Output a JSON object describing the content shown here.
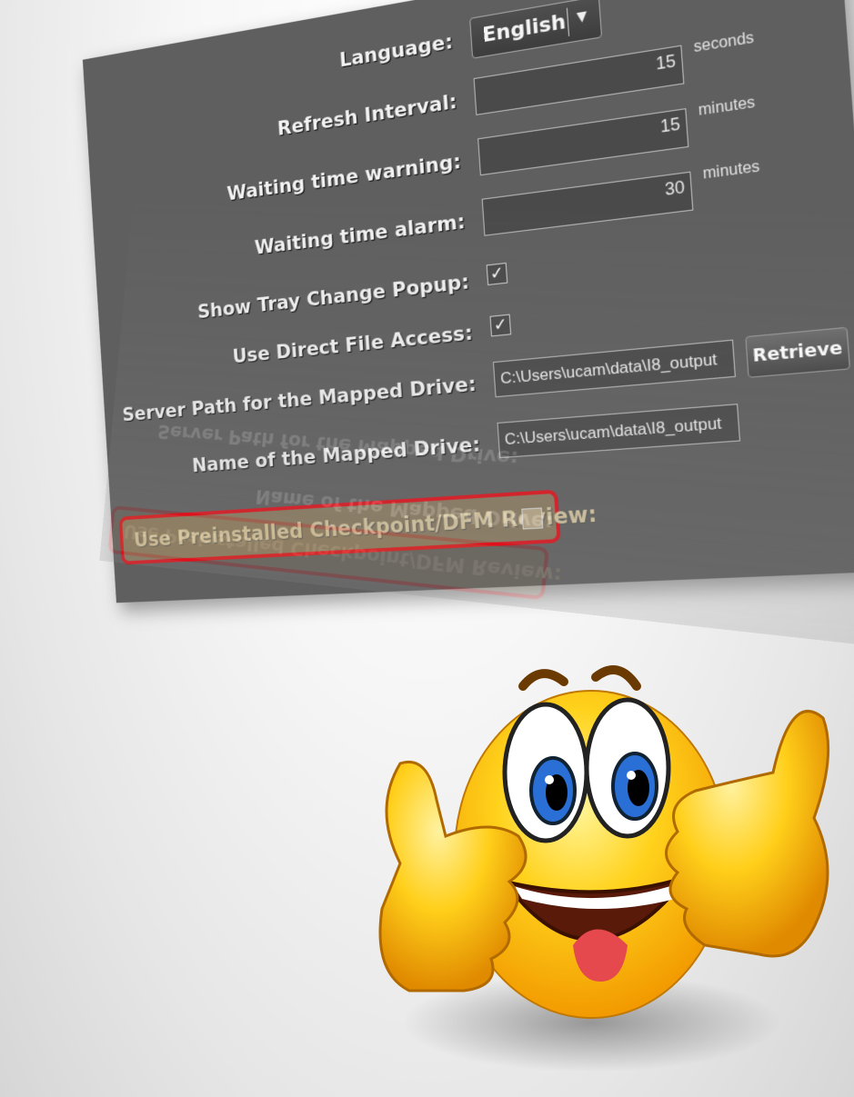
{
  "settings": {
    "language": {
      "label": "Language:",
      "value": "English"
    },
    "refresh": {
      "label": "Refresh Interval:",
      "value": "15",
      "unit": "seconds"
    },
    "warning": {
      "label": "Waiting time warning:",
      "value": "15",
      "unit": "minutes"
    },
    "alarm": {
      "label": "Waiting time alarm:",
      "value": "30",
      "unit": "minutes"
    },
    "tray": {
      "label": "Show Tray Change Popup:",
      "checked": true
    },
    "direct": {
      "label": "Use Direct File Access:",
      "checked": true
    },
    "server_path": {
      "label": "Server Path for the Mapped Drive:",
      "value": "C:\\Users\\ucam\\data\\I8_output",
      "button": "Retrieve"
    },
    "mapped_name": {
      "label": "Name of the Mapped Drive:",
      "value": "C:\\Users\\ucam\\data\\I8_output"
    },
    "preinstalled": {
      "label": "Use Preinstalled Checkpoint/DFM Review:",
      "checked": false
    }
  },
  "colors": {
    "panel": "#5f5f5f",
    "highlight_border": "#e0101a",
    "highlight_fill": "#8a7a60"
  },
  "icons": {
    "dropdown": "chevron-down-icon",
    "check": "checkmark-icon",
    "mascot": "thumbs-up-smiley-icon"
  }
}
